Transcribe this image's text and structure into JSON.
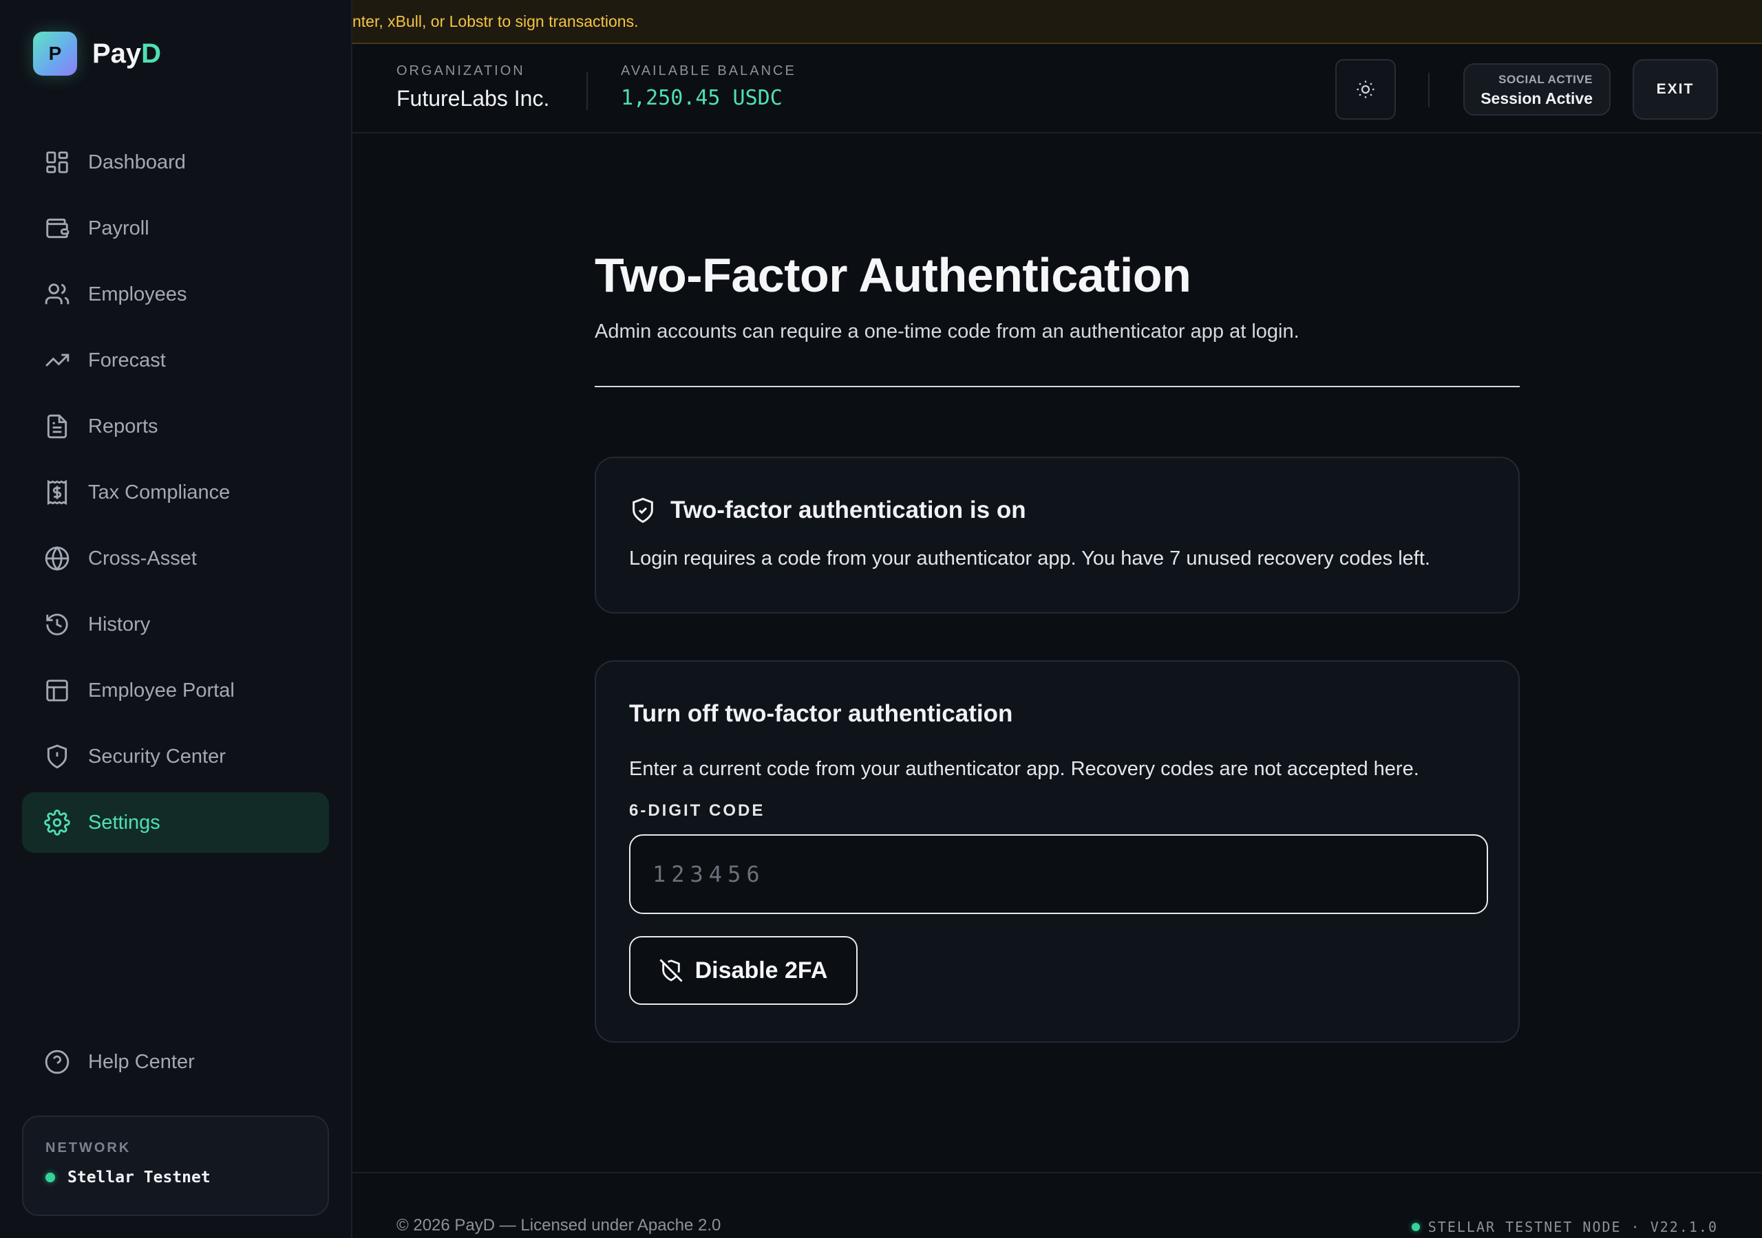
{
  "app": {
    "name_main": "Pay",
    "name_accent": "D",
    "logo_letter": "P"
  },
  "banner": {
    "text": "nter, xBull, or Lobstr to sign transactions."
  },
  "header": {
    "org_label": "ORGANIZATION",
    "org_name": "FutureLabs Inc.",
    "balance_label": "AVAILABLE BALANCE",
    "balance_value": "1,250.45 USDC",
    "session_top": "SOCIAL ACTIVE",
    "session_main": "Session Active",
    "exit_label": "EXIT"
  },
  "sidebar": {
    "items": [
      {
        "label": "Dashboard",
        "icon": "dashboard-icon"
      },
      {
        "label": "Payroll",
        "icon": "wallet-icon"
      },
      {
        "label": "Employees",
        "icon": "users-icon"
      },
      {
        "label": "Forecast",
        "icon": "trending-up-icon"
      },
      {
        "label": "Reports",
        "icon": "file-text-icon"
      },
      {
        "label": "Tax Compliance",
        "icon": "receipt-icon"
      },
      {
        "label": "Cross-Asset",
        "icon": "globe-icon"
      },
      {
        "label": "History",
        "icon": "history-icon"
      },
      {
        "label": "Employee Portal",
        "icon": "layout-icon"
      },
      {
        "label": "Security Center",
        "icon": "shield-alert-icon"
      },
      {
        "label": "Settings",
        "icon": "gear-icon",
        "active": true
      }
    ],
    "help_label": "Help Center",
    "network_label": "NETWORK",
    "network_value": "Stellar Testnet"
  },
  "main": {
    "title": "Two-Factor Authentication",
    "subtitle": "Admin accounts can require a one-time code from an authenticator app at login.",
    "status_card": {
      "heading": "Two-factor authentication is on",
      "text": "Login requires a code from your authenticator app. You have 7 unused recovery codes left."
    },
    "disable_card": {
      "heading": "Turn off two-factor authentication",
      "text": "Enter a current code from your authenticator app. Recovery codes are not accepted here.",
      "field_label": "6-DIGIT CODE",
      "placeholder": "123456",
      "value": "",
      "button_label": "Disable 2FA"
    }
  },
  "footer": {
    "copyright": "© 2026 PayD — Licensed under Apache 2.0",
    "node": "STELLAR TESTNET NODE · V22.1.0"
  },
  "colors": {
    "accent": "#4fe0b4",
    "warning": "#f4c542",
    "background": "#0b0e13",
    "sidebar": "#0e1218"
  }
}
